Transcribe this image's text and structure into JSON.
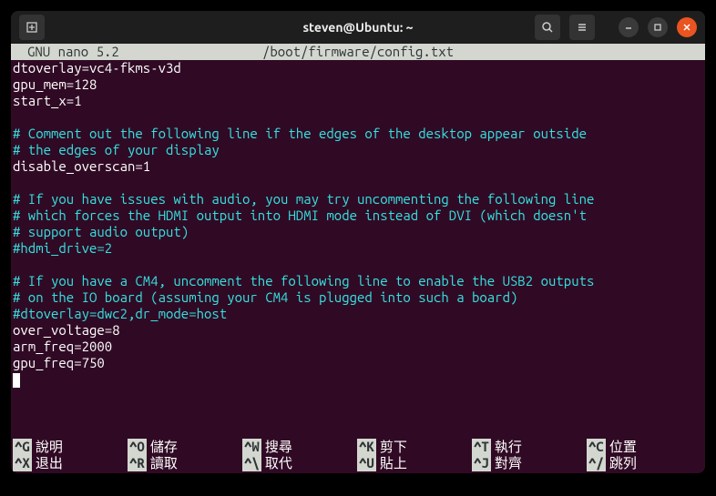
{
  "titlebar": {
    "title": "steven@Ubuntu: ~"
  },
  "nano": {
    "version": "GNU nano 5.2",
    "filepath": "/boot/firmware/config.txt"
  },
  "lines": [
    {
      "t": "cfg",
      "text": "dtoverlay=vc4-fkms-v3d"
    },
    {
      "t": "cfg",
      "text": "gpu_mem=128"
    },
    {
      "t": "cfg",
      "text": "start_x=1"
    },
    {
      "t": "cfg",
      "text": ""
    },
    {
      "t": "comment",
      "text": "# Comment out the following line if the edges of the desktop appear outside"
    },
    {
      "t": "comment",
      "text": "# the edges of your display"
    },
    {
      "t": "cfg",
      "text": "disable_overscan=1"
    },
    {
      "t": "cfg",
      "text": ""
    },
    {
      "t": "comment",
      "text": "# If you have issues with audio, you may try uncommenting the following line"
    },
    {
      "t": "comment",
      "text": "# which forces the HDMI output into HDMI mode instead of DVI (which doesn't"
    },
    {
      "t": "comment",
      "text": "# support audio output)"
    },
    {
      "t": "comment",
      "text": "#hdmi_drive=2"
    },
    {
      "t": "cfg",
      "text": ""
    },
    {
      "t": "comment",
      "text": "# If you have a CM4, uncomment the following line to enable the USB2 outputs"
    },
    {
      "t": "comment",
      "text": "# on the IO board (assuming your CM4 is plugged into such a board)"
    },
    {
      "t": "comment",
      "text": "#dtoverlay=dwc2,dr_mode=host"
    },
    {
      "t": "cfg",
      "text": "over_voltage=8"
    },
    {
      "t": "cfg",
      "text": "arm_freq=2000"
    },
    {
      "t": "cfg",
      "text": "gpu_freq=750"
    }
  ],
  "shortcuts": {
    "row1": [
      {
        "key": "^G",
        "label": "說明"
      },
      {
        "key": "^O",
        "label": "儲存"
      },
      {
        "key": "^W",
        "label": "搜尋"
      },
      {
        "key": "^K",
        "label": "剪下"
      },
      {
        "key": "^T",
        "label": "執行"
      },
      {
        "key": "^C",
        "label": "位置"
      }
    ],
    "row2": [
      {
        "key": "^X",
        "label": "退出"
      },
      {
        "key": "^R",
        "label": "讀取"
      },
      {
        "key": "^\\",
        "label": "取代"
      },
      {
        "key": "^U",
        "label": "貼上"
      },
      {
        "key": "^J",
        "label": "對齊"
      },
      {
        "key": "^/",
        "label": "跳列"
      }
    ]
  }
}
